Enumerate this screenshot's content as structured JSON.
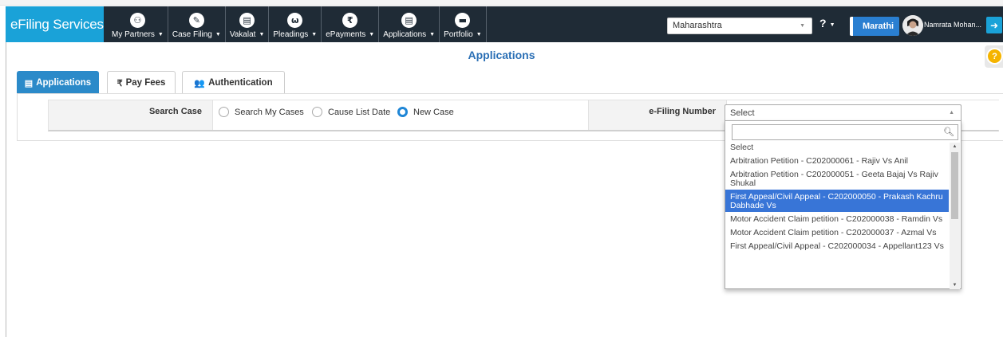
{
  "brand": "eFiling Services",
  "nav": [
    {
      "icon": "⚇",
      "label": "My Partners"
    },
    {
      "icon": "✎",
      "label": "Case Filing"
    },
    {
      "icon": "▤",
      "label": "Vakalat"
    },
    {
      "icon": "ω",
      "label": "Pleadings"
    },
    {
      "icon": "₹",
      "label": "ePayments"
    },
    {
      "icon": "▤",
      "label": "Applications"
    },
    {
      "icon": "▬",
      "label": "Portfolio"
    }
  ],
  "header": {
    "state": "Maharashtra",
    "help": "?",
    "language": "Marathi",
    "user": "Namrata Mohan..."
  },
  "page_title": "Applications",
  "tabs": [
    {
      "icon": "▤",
      "label": "Applications"
    },
    {
      "icon": "₹",
      "label": "Pay Fees"
    },
    {
      "icon": "👥",
      "label": "Authentication"
    }
  ],
  "search": {
    "label": "Search Case",
    "options": [
      "Search My Cases",
      "Cause List Date",
      "New Case"
    ],
    "selected": "New Case"
  },
  "efiling": {
    "label": "e-Filing Number",
    "selected": "Select",
    "search_value": "",
    "options": [
      "Select",
      "Arbitration Petition - C202000061 - Rajiv Vs Anil",
      "Arbitration Petition - C202000051 - Geeta Bajaj Vs Rajiv Shukal",
      "First Appeal/Civil Appeal - C202000050 - Prakash Kachru Dabhade Vs",
      "Motor Accident Claim petition - C202000038 - Ramdin Vs",
      "Motor Accident Claim petition - C202000037 - Azmal Vs",
      "First Appeal/Civil Appeal - C202000034 - Appellant123 Vs"
    ],
    "highlighted": "First Appeal/Civil Appeal - C202000050 - Prakash Kachru Dabhade Vs"
  }
}
